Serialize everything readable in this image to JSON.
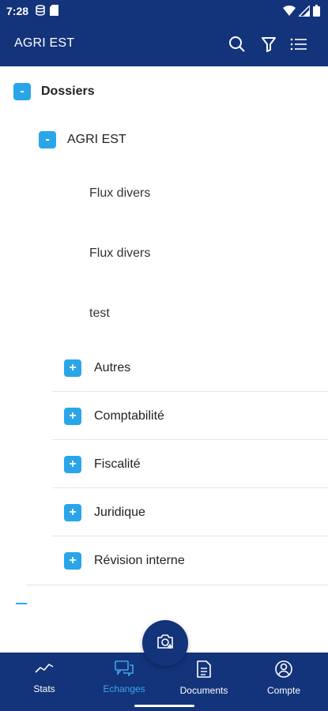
{
  "statusbar": {
    "time": "7:28"
  },
  "appbar": {
    "title": "AGRI EST"
  },
  "tree": {
    "root": {
      "label": "Dossiers",
      "toggle": "-"
    },
    "company": {
      "label": "AGRI EST",
      "toggle": "-"
    },
    "leaves": [
      "Flux divers",
      "Flux divers",
      "test"
    ],
    "folders": [
      {
        "label": "Autres",
        "toggle": "+"
      },
      {
        "label": "Comptabilité",
        "toggle": "+"
      },
      {
        "label": "Fiscalité",
        "toggle": "+"
      },
      {
        "label": "Juridique",
        "toggle": "+"
      },
      {
        "label": "Révision interne",
        "toggle": "+"
      }
    ]
  },
  "bottomnav": {
    "items": [
      {
        "label": "Stats",
        "icon": "trend-line-icon"
      },
      {
        "label": "Echanges",
        "icon": "chat-icon"
      },
      {
        "label": "Documents",
        "icon": "document-icon"
      },
      {
        "label": "Compte",
        "icon": "account-icon"
      }
    ],
    "active": "Echanges"
  },
  "colors": {
    "primary": "#13337a",
    "accent": "#2aa6e8",
    "active": "#3fa5e8"
  }
}
